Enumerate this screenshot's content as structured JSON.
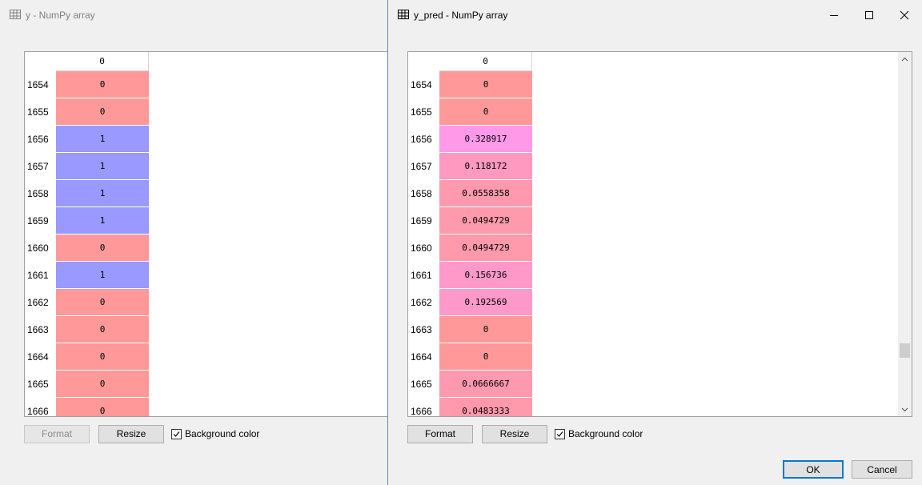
{
  "left_window": {
    "title": "y - NumPy array",
    "column_header": "0",
    "rows": [
      {
        "index": "1654",
        "value": "0",
        "color": "#ff9999"
      },
      {
        "index": "1655",
        "value": "0",
        "color": "#ff9999"
      },
      {
        "index": "1656",
        "value": "1",
        "color": "#9999ff"
      },
      {
        "index": "1657",
        "value": "1",
        "color": "#9999ff"
      },
      {
        "index": "1658",
        "value": "1",
        "color": "#9999ff"
      },
      {
        "index": "1659",
        "value": "1",
        "color": "#9999ff"
      },
      {
        "index": "1660",
        "value": "0",
        "color": "#ff9999"
      },
      {
        "index": "1661",
        "value": "1",
        "color": "#9999ff"
      },
      {
        "index": "1662",
        "value": "0",
        "color": "#ff9999"
      },
      {
        "index": "1663",
        "value": "0",
        "color": "#ff9999"
      },
      {
        "index": "1664",
        "value": "0",
        "color": "#ff9999"
      },
      {
        "index": "1665",
        "value": "0",
        "color": "#ff9999"
      },
      {
        "index": "1666",
        "value": "0",
        "color": "#ff9999"
      }
    ],
    "format_label": "Format",
    "resize_label": "Resize",
    "background_color_label": "Background color",
    "background_color_checked": true
  },
  "right_window": {
    "title": "y_pred - NumPy array",
    "column_header": "0",
    "rows": [
      {
        "index": "1654",
        "value": "0",
        "color": "#ff9999"
      },
      {
        "index": "1655",
        "value": "0",
        "color": "#ff9999"
      },
      {
        "index": "1656",
        "value": "0.328917",
        "color": "#ff99e8"
      },
      {
        "index": "1657",
        "value": "0.118172",
        "color": "#ff99bf"
      },
      {
        "index": "1658",
        "value": "0.0558358",
        "color": "#ff99ad"
      },
      {
        "index": "1659",
        "value": "0.0494729",
        "color": "#ff99ab"
      },
      {
        "index": "1660",
        "value": "0.0494729",
        "color": "#ff99ab"
      },
      {
        "index": "1661",
        "value": "0.156736",
        "color": "#ff99ca"
      },
      {
        "index": "1662",
        "value": "0.192569",
        "color": "#ff99c9"
      },
      {
        "index": "1663",
        "value": "0",
        "color": "#ff9999"
      },
      {
        "index": "1664",
        "value": "0",
        "color": "#ff9999"
      },
      {
        "index": "1665",
        "value": "0.0666667",
        "color": "#ff99af"
      },
      {
        "index": "1666",
        "value": "0.0483333",
        "color": "#ff99ab"
      }
    ],
    "format_label": "Format",
    "resize_label": "Resize",
    "background_color_label": "Background color",
    "background_color_checked": true,
    "ok_label": "OK",
    "cancel_label": "Cancel",
    "scroll_position": 0.86
  }
}
